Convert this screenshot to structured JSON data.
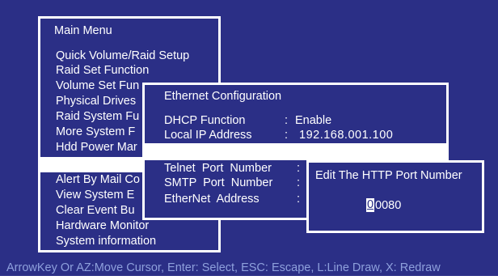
{
  "main_menu": {
    "title": "Main Menu",
    "items": [
      "Quick Volume/Raid Setup",
      "Raid Set Function",
      "Volume Set Function",
      "Physical Drives",
      "Raid System Function",
      "More System Functions",
      "Hdd Power Management",
      "Ethernet Configuration",
      "Alert By Mail Config",
      "View System Events",
      "Clear Event Buffer",
      "Hardware Monitor",
      "System information"
    ],
    "visible": [
      "Quick Volume/Raid Setup",
      "Raid Set Function",
      "Volume Set Fun",
      "Physical Drives",
      "Raid System Fu",
      "More System F",
      "Hdd Power Mar",
      "",
      "Alert By Mail Co",
      "View System E",
      "Clear Event Bu",
      "Hardware Monitor",
      "System information"
    ]
  },
  "ethernet": {
    "title": "Ethernet Configuration",
    "dhcp_label": "DHCP Function",
    "dhcp_sep": ":",
    "dhcp_value": "Enable",
    "ip_label": "Local IP Address",
    "ip_sep": ":",
    "ip_value": "192.168.001.100",
    "telnet_label": "Telnet  Port  Number",
    "telnet_sep": ":",
    "smtp_label": "SMTP  Port  Number",
    "smtp_sep": ":",
    "mac_label": "EtherNet  Address",
    "mac_sep": ":"
  },
  "http_dialog": {
    "title": "Edit The HTTP Port Number",
    "cursor_digit": "0",
    "rest_digits": "0080"
  },
  "status_bar": "ArrowKey Or AZ:Move Cursor, Enter: Select, ESC: Escape, L:Line Draw, X: Redraw",
  "colors": {
    "background": "#2b2f86",
    "foreground": "#ffffff",
    "status_text": "#8ea0dc"
  }
}
